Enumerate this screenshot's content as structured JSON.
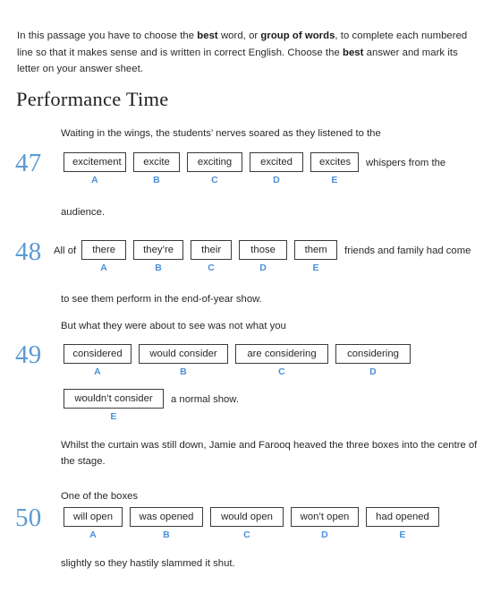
{
  "document": {
    "instructions": {
      "parts": [
        {
          "text": "In this passage you have to choose the ",
          "bold": false
        },
        {
          "text": "best",
          "bold": true
        },
        {
          "text": " word, or ",
          "bold": false
        },
        {
          "text": "group of words",
          "bold": true
        },
        {
          "text": ", to complete each numbered line so that it makes sense and is written in correct English. Choose the ",
          "bold": false
        },
        {
          "text": "best",
          "bold": true
        },
        {
          "text": " answer and mark its letter on your answer sheet.",
          "bold": false
        }
      ]
    },
    "section_title": "Performance Time",
    "colors": {
      "question_number": "#5b9bd5",
      "option_letter": "#4a90d9",
      "body_text": "#2b2727",
      "box_border": "#3b3b3b",
      "page_background": "#ffffff"
    },
    "passage_lines": {
      "line_47_intro": "Waiting in the wings, the students’ nerves soared as they listened to the",
      "line_47_after": "audience.",
      "line_48_after": "to see them perform in the end-of-year show.",
      "line_49_intro": "But what they were about to see was not what you",
      "line_50_intro_a": "Whilst the curtain was still down, Jamie and Farooq heaved the three boxes into the centre of the stage.",
      "line_50_intro_b": "One of the boxes",
      "line_50_after": "slightly so they hastily slammed it shut."
    },
    "questions": [
      {
        "number": "47",
        "lead_text": "",
        "trail_text": "whispers from the",
        "options": [
          {
            "letter": "A",
            "text": "excitement"
          },
          {
            "letter": "B",
            "text": "excite"
          },
          {
            "letter": "C",
            "text": "exciting"
          },
          {
            "letter": "D",
            "text": "excited"
          },
          {
            "letter": "E",
            "text": "excites"
          }
        ]
      },
      {
        "number": "48",
        "lead_text": "All of",
        "trail_text": "friends and family had come",
        "options": [
          {
            "letter": "A",
            "text": "there"
          },
          {
            "letter": "B",
            "text": "they’re"
          },
          {
            "letter": "C",
            "text": "their"
          },
          {
            "letter": "D",
            "text": "those"
          },
          {
            "letter": "E",
            "text": "them"
          }
        ]
      },
      {
        "number": "49",
        "lead_text": "",
        "trail_text": "",
        "options": [
          {
            "letter": "A",
            "text": "considered"
          },
          {
            "letter": "B",
            "text": "would consider"
          },
          {
            "letter": "C",
            "text": "are considering"
          },
          {
            "letter": "D",
            "text": "considering"
          }
        ],
        "options_second_row": [
          {
            "letter": "E",
            "text": "wouldn’t consider"
          }
        ],
        "second_row_trail_text": "a normal show."
      },
      {
        "number": "50",
        "lead_text": "",
        "trail_text": "",
        "options": [
          {
            "letter": "A",
            "text": "will open"
          },
          {
            "letter": "B",
            "text": "was opened"
          },
          {
            "letter": "C",
            "text": "would open"
          },
          {
            "letter": "D",
            "text": "won’t open"
          },
          {
            "letter": "E",
            "text": "had opened"
          }
        ]
      }
    ]
  }
}
